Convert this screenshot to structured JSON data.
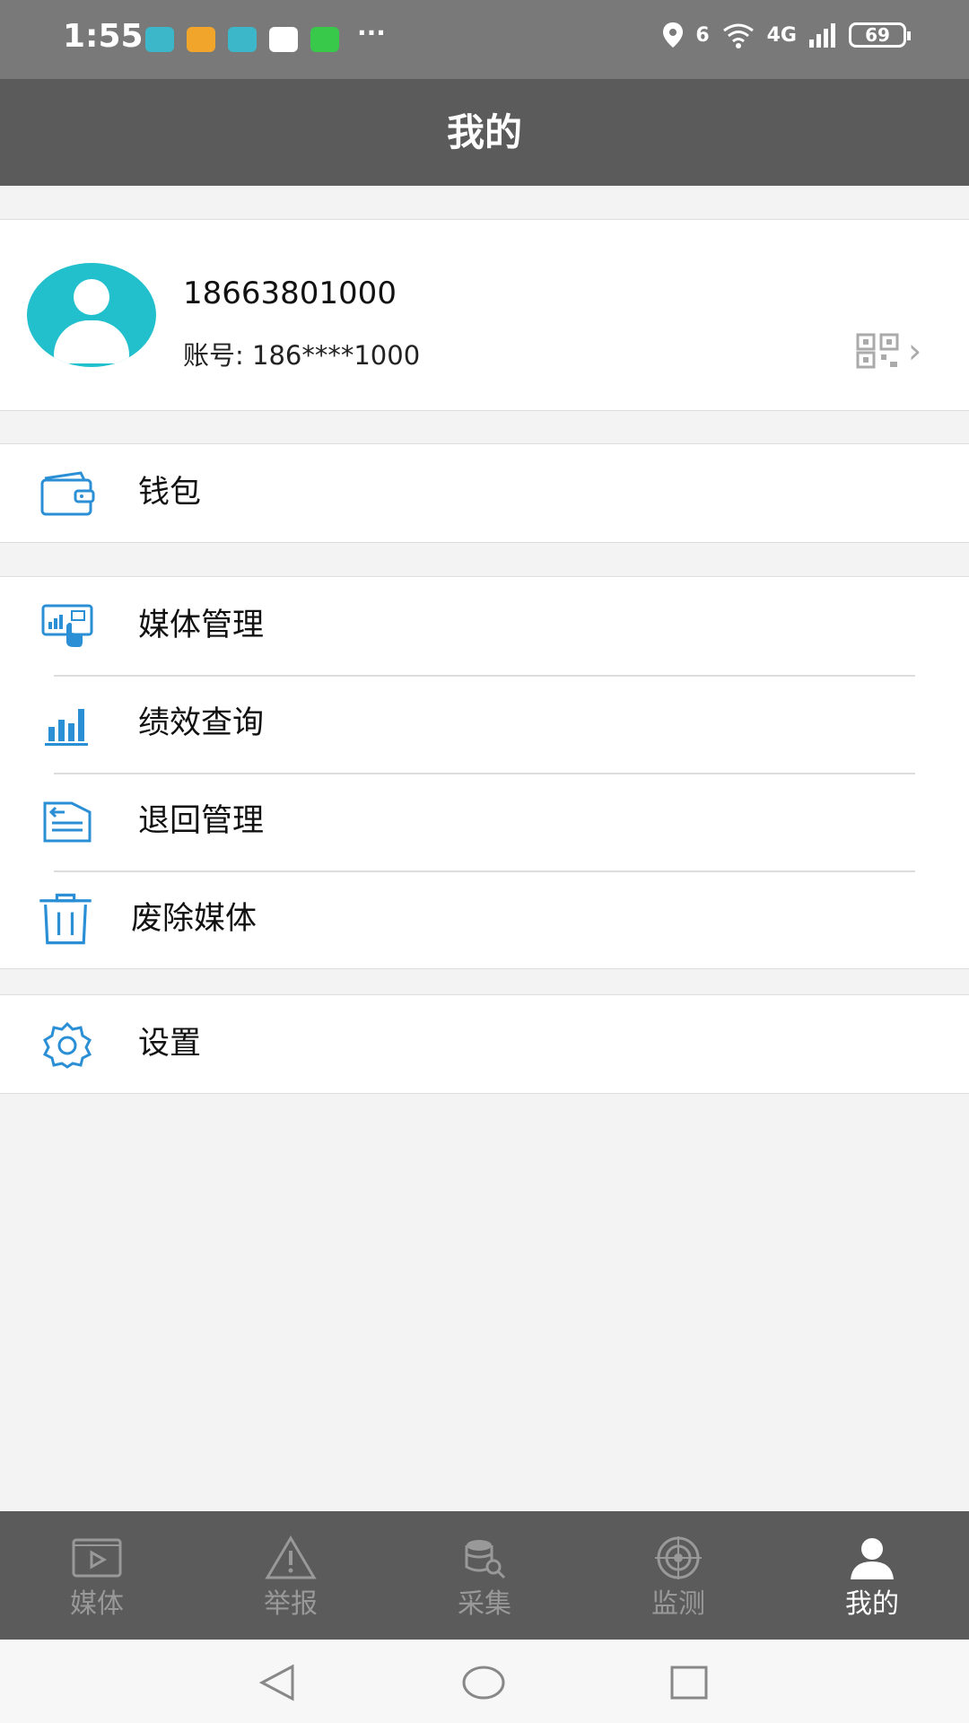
{
  "status_bar": {
    "time": "1:55",
    "more": "···",
    "network_badge": "6",
    "network_type": "4G",
    "battery": "69"
  },
  "header": {
    "title": "我的"
  },
  "profile": {
    "phone": "18663801000",
    "account_label": "账号:",
    "account_value": "186****1000"
  },
  "menu": {
    "wallet": "钱包",
    "media_manage": "媒体管理",
    "performance": "绩效查询",
    "return_manage": "退回管理",
    "abolish_media": "废除媒体",
    "settings": "设置"
  },
  "bottom_nav": [
    {
      "label": "媒体",
      "icon": "video-icon"
    },
    {
      "label": "举报",
      "icon": "warning-icon"
    },
    {
      "label": "采集",
      "icon": "database-search-icon"
    },
    {
      "label": "监测",
      "icon": "target-icon"
    },
    {
      "label": "我的",
      "icon": "user-icon",
      "active": true
    }
  ],
  "colors": {
    "accent": "#22c0cd",
    "icon_blue": "#2b8fd6",
    "header_bg": "#5b5b5b",
    "status_bg": "#797979"
  }
}
